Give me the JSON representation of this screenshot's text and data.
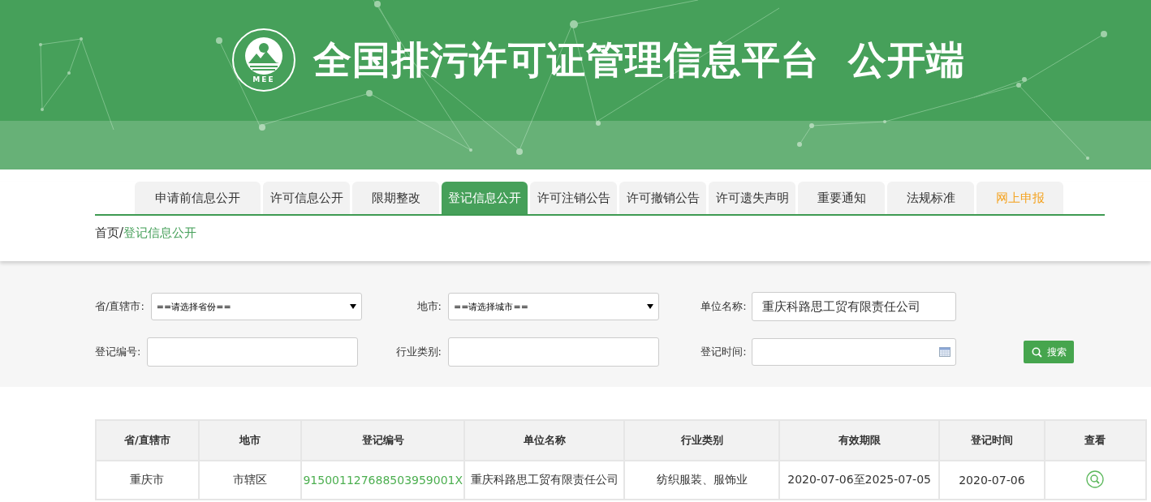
{
  "header": {
    "logo_text": "MEE",
    "title": "全国排污许可证管理信息平台  公开端"
  },
  "tabs": [
    {
      "label": "申请前信息公开",
      "selected": false,
      "highlighted": false
    },
    {
      "label": "许可信息公开",
      "selected": false,
      "highlighted": false
    },
    {
      "label": "限期整改",
      "selected": false,
      "highlighted": false
    },
    {
      "label": "登记信息公开",
      "selected": true,
      "highlighted": false
    },
    {
      "label": "许可注销公告",
      "selected": false,
      "highlighted": false
    },
    {
      "label": "许可撤销公告",
      "selected": false,
      "highlighted": false
    },
    {
      "label": "许可遗失声明",
      "selected": false,
      "highlighted": false
    },
    {
      "label": "重要通知",
      "selected": false,
      "highlighted": false
    },
    {
      "label": "法规标准",
      "selected": false,
      "highlighted": false
    },
    {
      "label": "网上申报",
      "selected": false,
      "highlighted": true
    }
  ],
  "breadcrumb": {
    "home": "首页",
    "separator": "/",
    "current": "登记信息公开"
  },
  "filters": [
    {
      "label": "省/直辖市:",
      "kind": "select",
      "value": "==请选择省份=="
    },
    {
      "label": "地市:",
      "kind": "select",
      "value": "==请选择城市=="
    },
    {
      "label": "单位名称:",
      "kind": "input",
      "value": "重庆科路思工贸有限责任公司"
    },
    {
      "label": "登记编号:",
      "kind": "input"
    },
    {
      "label": "行业类别:",
      "kind": "input"
    },
    {
      "label": "登记时间:",
      "kind": "date"
    }
  ],
  "search_button": "搜索",
  "table": {
    "columns": [
      "省/直辖市",
      "地市",
      "登记编号",
      "单位名称",
      "行业类别",
      "有效期限",
      "登记时间",
      "查看"
    ],
    "rows": [
      {
        "cells": [
          {
            "kind": "text",
            "text": "重庆市"
          },
          {
            "kind": "text",
            "text": "市辖区"
          },
          {
            "kind": "link",
            "text": "915001127688503959001X"
          },
          {
            "kind": "text",
            "text": "重庆科路思工贸有限责任公司"
          },
          {
            "kind": "text",
            "text": "纺织服装、服饰业"
          },
          {
            "kind": "text",
            "text": "2020-07-06至2025-07-05"
          },
          {
            "kind": "text",
            "text": "2020-07-06"
          },
          {
            "kind": "view"
          }
        ]
      }
    ]
  }
}
